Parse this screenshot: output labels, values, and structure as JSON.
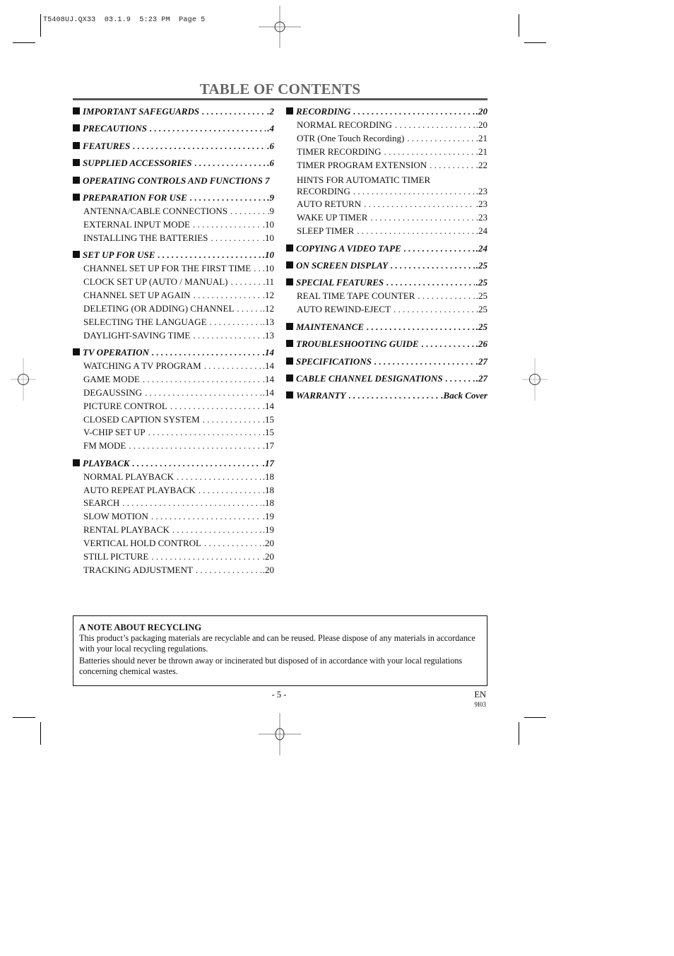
{
  "slug": "T5408UJ.QX33  03.1.9  5:23 PM  Page 5",
  "title": "TABLE OF CONTENTS",
  "left_column": [
    {
      "type": "main",
      "label": "IMPORTANT SAFEGUARDS",
      "page": ".2"
    },
    {
      "type": "main",
      "label": "PRECAUTIONS",
      "page": ".4"
    },
    {
      "type": "main",
      "label": "FEATURES",
      "page": ".6"
    },
    {
      "type": "main",
      "label": "SUPPLIED ACCESSORIES",
      "page": ".6"
    },
    {
      "type": "main",
      "label": "OPERATING CONTROLS AND FUNCTIONS 7",
      "page": ""
    },
    {
      "type": "main",
      "label": "PREPARATION FOR USE",
      "page": ".9"
    },
    {
      "type": "sub",
      "label": "ANTENNA/CABLE CONNECTIONS",
      "page": ".9"
    },
    {
      "type": "sub",
      "label": "EXTERNAL INPUT MODE",
      "page": ".10"
    },
    {
      "type": "sub",
      "label": "INSTALLING THE BATTERIES",
      "page": ".10"
    },
    {
      "type": "main",
      "label": "SET UP FOR USE",
      "page": ".10"
    },
    {
      "type": "sub",
      "label": "CHANNEL SET UP FOR THE FIRST TIME",
      "page": ".10"
    },
    {
      "type": "sub",
      "label": "CLOCK SET UP (AUTO / MANUAL)",
      "page": ".11"
    },
    {
      "type": "sub",
      "label": "CHANNEL SET UP AGAIN",
      "page": ".12"
    },
    {
      "type": "sub",
      "label": "DELETING (OR ADDING) CHANNEL",
      "page": ".12"
    },
    {
      "type": "sub",
      "label": "SELECTING THE LANGUAGE",
      "page": ".13"
    },
    {
      "type": "sub",
      "label": "DAYLIGHT-SAVING TIME",
      "page": ".13"
    },
    {
      "type": "main",
      "label": "TV OPERATION",
      "page": ".14"
    },
    {
      "type": "sub",
      "label": "WATCHING A TV PROGRAM",
      "page": ".14"
    },
    {
      "type": "sub",
      "label": "GAME MODE",
      "page": ".14"
    },
    {
      "type": "sub",
      "label": "DEGAUSSING",
      "page": ".14"
    },
    {
      "type": "sub",
      "label": "PICTURE CONTROL",
      "page": ".14"
    },
    {
      "type": "sub",
      "label": "CLOSED CAPTION SYSTEM",
      "page": ".15"
    },
    {
      "type": "sub",
      "label": "V-CHIP SET UP",
      "page": ".15"
    },
    {
      "type": "sub",
      "label": "FM MODE",
      "page": ".17"
    },
    {
      "type": "main",
      "label": "PLAYBACK",
      "page": ".17"
    },
    {
      "type": "sub",
      "label": "NORMAL PLAYBACK",
      "page": ".18"
    },
    {
      "type": "sub",
      "label": "AUTO REPEAT PLAYBACK",
      "page": ".18"
    },
    {
      "type": "sub",
      "label": "SEARCH",
      "page": ".18"
    },
    {
      "type": "sub",
      "label": "SLOW MOTION",
      "page": ".19"
    },
    {
      "type": "sub",
      "label": "RENTAL PLAYBACK",
      "page": ".19"
    },
    {
      "type": "sub",
      "label": "VERTICAL HOLD CONTROL",
      "page": ".20"
    },
    {
      "type": "sub",
      "label": "STILL PICTURE",
      "page": ".20"
    },
    {
      "type": "sub",
      "label": "TRACKING ADJUSTMENT",
      "page": ".20"
    }
  ],
  "right_column": [
    {
      "type": "main",
      "label": "RECORDING",
      "page": ".20"
    },
    {
      "type": "sub",
      "label": "NORMAL RECORDING",
      "page": ".20"
    },
    {
      "type": "sub",
      "label": "OTR (One Touch Recording)",
      "page": ".21"
    },
    {
      "type": "sub",
      "label": "TIMER RECORDING",
      "page": ".21"
    },
    {
      "type": "sub",
      "label": "TIMER PROGRAM EXTENSION",
      "page": ".22"
    },
    {
      "type": "sub-wrap",
      "label_line1": "HINTS FOR AUTOMATIC TIMER",
      "label": "RECORDING",
      "page": ".23"
    },
    {
      "type": "sub",
      "label": "AUTO RETURN",
      "page": ".23"
    },
    {
      "type": "sub",
      "label": "WAKE UP TIMER",
      "page": ".23"
    },
    {
      "type": "sub",
      "label": "SLEEP TIMER",
      "page": ".24"
    },
    {
      "type": "main",
      "label": "COPYING A VIDEO TAPE",
      "page": ".24"
    },
    {
      "type": "main",
      "label": "ON SCREEN DISPLAY",
      "page": ".25"
    },
    {
      "type": "main",
      "label": "SPECIAL FEATURES",
      "page": ".25"
    },
    {
      "type": "sub",
      "label": "REAL TIME TAPE COUNTER",
      "page": ".25"
    },
    {
      "type": "sub",
      "label": "AUTO REWIND-EJECT",
      "page": ".25"
    },
    {
      "type": "main",
      "label": "MAINTENANCE",
      "page": ".25"
    },
    {
      "type": "main",
      "label": "TROUBLESHOOTING GUIDE",
      "page": ".26"
    },
    {
      "type": "main",
      "label": "SPECIFICATIONS",
      "page": ".27"
    },
    {
      "type": "main",
      "label": "CABLE CHANNEL DESIGNATIONS",
      "page": ".27"
    },
    {
      "type": "main",
      "label": "WARRANTY",
      "page": ".Back Cover"
    }
  ],
  "note": {
    "title": "A NOTE ABOUT RECYCLING",
    "paragraph1": "This product’s packaging materials are recyclable and can be reused. Please dispose of any materials in accordance with your local recycling regulations.",
    "paragraph2": "Batteries should never be thrown away or incinerated but disposed of in accordance with your local regulations concerning chemical wastes."
  },
  "footer": {
    "page_number": "- 5 -",
    "language": "EN",
    "code": "9I03"
  },
  "colors": {
    "title": "#666666",
    "rule": "#555555",
    "text": "#111111"
  }
}
